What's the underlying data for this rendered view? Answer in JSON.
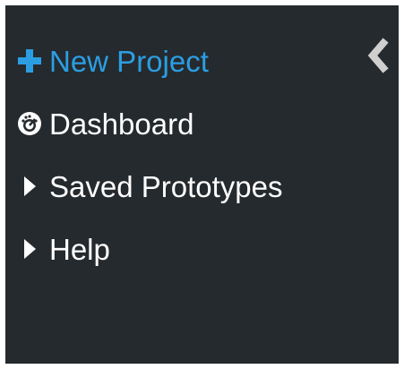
{
  "colors": {
    "panel_background": "#252a2e",
    "text": "#ffffff",
    "accent": "#2b9ee3",
    "collapse_icon": "#cfcfcf"
  },
  "sidebar": {
    "collapse_icon": "chevron-left-icon",
    "items": [
      {
        "label": "New Project",
        "icon": "plus-icon"
      },
      {
        "label": "Dashboard",
        "icon": "dashboard-gauge-icon"
      },
      {
        "label": "Saved Prototypes",
        "icon": "caret-right-icon"
      },
      {
        "label": "Help",
        "icon": "caret-right-icon"
      }
    ]
  }
}
